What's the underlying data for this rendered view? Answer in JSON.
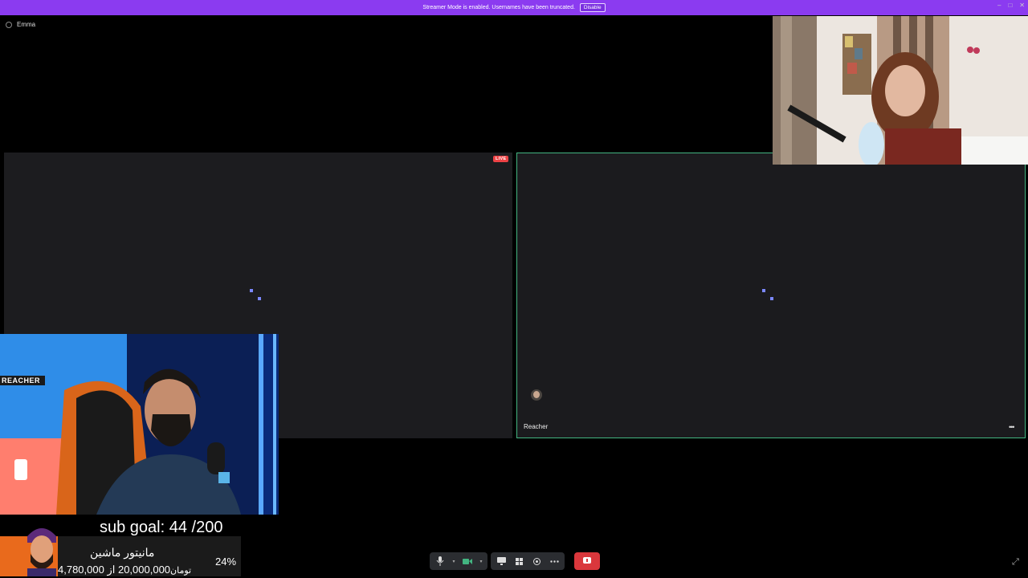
{
  "banner": {
    "text": "Streamer Mode is enabled. Usernames have been truncated.",
    "button": "Disable"
  },
  "window_controls": [
    "–",
    "□",
    "✕"
  ],
  "channel": {
    "name": "Emma"
  },
  "tiles": {
    "left": {
      "live_badge": "LIVE"
    },
    "right": {
      "name": "Reacher",
      "more": "•••"
    }
  },
  "streamer_cam": {
    "overlay_label": "REACHER"
  },
  "sub_goal": {
    "label": "sub goal: 44 /200",
    "title": "مانیتور ماشین",
    "amount": "20,000,000 از 4,780,000",
    "tag": "تومان",
    "percent_text": "24%",
    "progress": 0.24
  },
  "toolbar": {
    "icons": [
      "microphone-icon",
      "chevron-down-icon",
      "camera-icon",
      "chevron-down-icon",
      "screen-share-icon",
      "activities-icon",
      "soundboard-icon",
      "more-icon",
      "disconnect-icon"
    ]
  },
  "colors": {
    "banner": "#8b3bf0",
    "speaking": "#43b581",
    "hangup": "#da373c",
    "live": "#ed4245"
  }
}
